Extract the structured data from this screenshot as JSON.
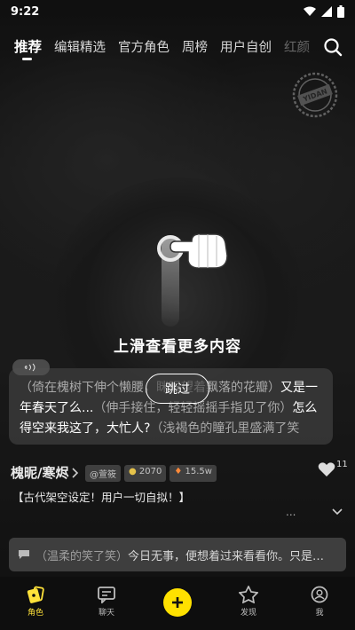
{
  "status": {
    "time": "9:22"
  },
  "tabs": [
    {
      "label": "推荐"
    },
    {
      "label": "编辑精选"
    },
    {
      "label": "官方角色"
    },
    {
      "label": "周榜"
    },
    {
      "label": "用户自创"
    },
    {
      "label": "红颜"
    }
  ],
  "stamp": {
    "text": "YIDAN"
  },
  "hint": {
    "text": "上滑查看更多内容"
  },
  "card": {
    "voice_label": "♪",
    "paren1": "（倚在槐树下伸个懒腰，眯眼望着飘落的花瓣）",
    "text1": "又是一年春天了么...",
    "paren2": "（伸手接住，轻轻摇摇手指见了你）",
    "text2": "怎么得空来我这了，大忙人?",
    "paren3": "（浅褐色的瞳孔里盛满了笑"
  },
  "skip": {
    "label": "跳过"
  },
  "character": {
    "name": "槐昵/寒烬",
    "author": "@萱筱",
    "stat1": "2070",
    "stat2": "15.5w",
    "like_count": "11",
    "description": "【古代架空设定！用户一切自拟！】",
    "more": "..."
  },
  "input": {
    "paren": "（温柔的笑了笑）",
    "text": "今日无事，便想着过来看看你。只是…"
  },
  "nav": [
    {
      "label": "角色"
    },
    {
      "label": "聊天"
    },
    {
      "label": ""
    },
    {
      "label": "发现"
    },
    {
      "label": "我"
    }
  ],
  "colors": {
    "accent": "#ffe100",
    "active_nav": "#ffe23a"
  }
}
